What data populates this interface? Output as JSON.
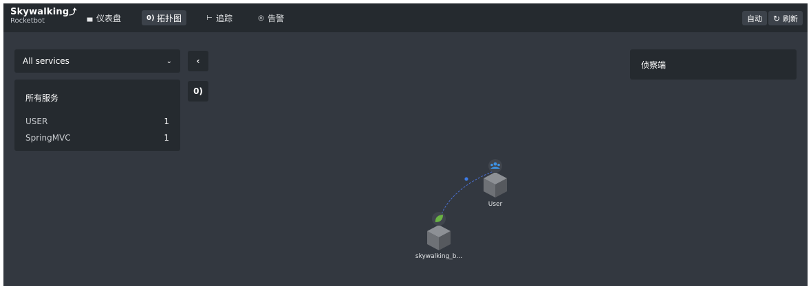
{
  "header": {
    "logo_title": "Skywalking",
    "logo_sub": "Rocketbot",
    "nav": [
      {
        "label": "仪表盘",
        "icon": "dashboard-icon"
      },
      {
        "label": "拓扑图",
        "icon": "topology-icon"
      },
      {
        "label": "追踪",
        "icon": "trace-icon"
      },
      {
        "label": "告警",
        "icon": "alarm-icon"
      }
    ],
    "auto_label": "自动",
    "refresh_label": "刷新"
  },
  "sidebar": {
    "select_value": "All services",
    "panel_title": "所有服务",
    "services": [
      {
        "name": "USER",
        "count": "1"
      },
      {
        "name": "SpringMVC",
        "count": "1"
      }
    ]
  },
  "detector": {
    "title": "侦察端"
  },
  "topology": {
    "nodes": [
      {
        "label": "User",
        "type": "user-icon"
      },
      {
        "label": "skywalking_b...",
        "type": "spring-leaf-icon"
      }
    ]
  },
  "colors": {
    "background": "#333840",
    "panel": "#252a2f",
    "topbar": "#252a2f",
    "accent_blue": "#3d92e3",
    "spring_green": "#6ab344",
    "link": "#4a6fd0"
  }
}
